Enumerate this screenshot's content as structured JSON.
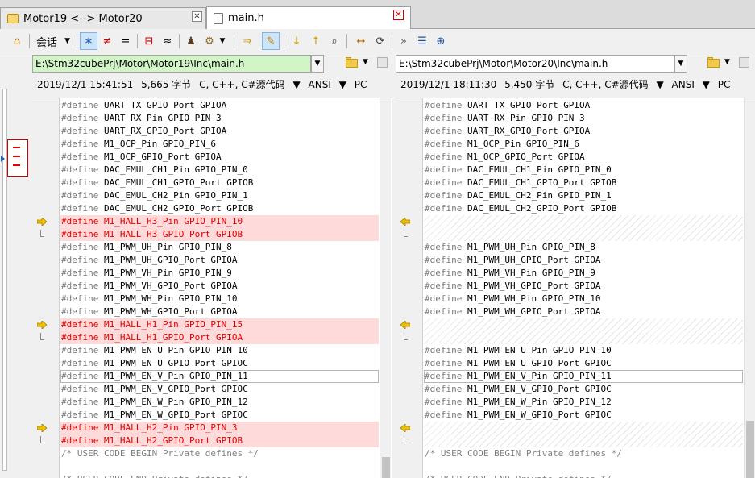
{
  "tabs": [
    {
      "label": "Motor19 <--> Motor20",
      "active": false
    },
    {
      "label": "main.h",
      "active": true
    }
  ],
  "toolbar": {
    "session_label": "会话",
    "items": [
      {
        "name": "home-icon",
        "glyph": "⌂"
      },
      {
        "name": "session-menu",
        "glyph": ""
      },
      {
        "name": "show-all-icon",
        "glyph": "∗"
      },
      {
        "name": "show-differences-icon",
        "glyph": "≠"
      },
      {
        "name": "show-same-icon",
        "glyph": "="
      },
      {
        "name": "structure-icon",
        "glyph": "⊟"
      },
      {
        "name": "similar-icon",
        "glyph": "≈"
      },
      {
        "name": "person-icon",
        "glyph": "♟"
      },
      {
        "name": "rules-icon",
        "glyph": "⚙"
      },
      {
        "name": "copy-arrow-icon",
        "glyph": "⇒"
      },
      {
        "name": "edit-pencil-icon",
        "glyph": "✎"
      },
      {
        "name": "next-diff-icon",
        "glyph": "↓"
      },
      {
        "name": "prev-diff-icon",
        "glyph": "↑"
      },
      {
        "name": "find-binoculars-icon",
        "glyph": "⌕"
      },
      {
        "name": "swap-icon",
        "glyph": "↔"
      },
      {
        "name": "refresh-icon",
        "glyph": "⟳"
      },
      {
        "name": "expand-icon",
        "glyph": "»"
      },
      {
        "name": "list-icon",
        "glyph": "☰"
      },
      {
        "name": "globe-icon",
        "glyph": "⊕"
      }
    ]
  },
  "left": {
    "path": "E:\\Stm32cubePrj\\Motor\\Motor19\\Inc\\main.h",
    "date": "2019/12/1 15:41:51",
    "size": "5,665 字节",
    "lang": "C, C++, C#源代码",
    "encoding": "ANSI",
    "lineend": "PC"
  },
  "right": {
    "path": "E:\\Stm32cubePrj\\Motor\\Motor20\\Inc\\main.h",
    "date": "2019/12/1 18:11:30",
    "size": "5,450 字节",
    "lang": "C, C++, C#源代码",
    "encoding": "ANSI",
    "lineend": "PC"
  },
  "rows": [
    {
      "left": "#define UART_TX_GPIO_Port GPIOA",
      "right": "#define UART_TX_GPIO_Port GPIOA",
      "type": "same"
    },
    {
      "left": "#define UART_RX_Pin GPIO_PIN_3",
      "right": "#define UART_RX_Pin GPIO_PIN_3",
      "type": "same"
    },
    {
      "left": "#define UART_RX_GPIO_Port GPIOA",
      "right": "#define UART_RX_GPIO_Port GPIOA",
      "type": "same"
    },
    {
      "left": "#define M1_OCP_Pin GPIO_PIN_6",
      "right": "#define M1_OCP_Pin GPIO_PIN_6",
      "type": "same"
    },
    {
      "left": "#define M1_OCP_GPIO_Port GPIOA",
      "right": "#define M1_OCP_GPIO_Port GPIOA",
      "type": "same"
    },
    {
      "left": "#define DAC_EMUL_CH1_Pin GPIO_PIN_0",
      "right": "#define DAC_EMUL_CH1_Pin GPIO_PIN_0",
      "type": "same"
    },
    {
      "left": "#define DAC_EMUL_CH1_GPIO_Port GPIOB",
      "right": "#define DAC_EMUL_CH1_GPIO_Port GPIOB",
      "type": "same"
    },
    {
      "left": "#define DAC_EMUL_CH2_Pin GPIO_PIN_1",
      "right": "#define DAC_EMUL_CH2_Pin GPIO_PIN_1",
      "type": "same"
    },
    {
      "left": "#define DAC_EMUL_CH2_GPIO_Port GPIOB",
      "right": "#define DAC_EMUL_CH2_GPIO_Port GPIOB",
      "type": "same"
    },
    {
      "left": "#define M1_HALL_H3_Pin GPIO_PIN_10",
      "right": "",
      "type": "diff-first"
    },
    {
      "left": "#define M1_HALL_H3_GPIO_Port GPIOB",
      "right": "",
      "type": "diff-cont"
    },
    {
      "left": "#define M1_PWM_UH_Pin GPIO_PIN_8",
      "right": "#define M1_PWM_UH_Pin GPIO_PIN_8",
      "type": "same"
    },
    {
      "left": "#define M1_PWM_UH_GPIO_Port GPIOA",
      "right": "#define M1_PWM_UH_GPIO_Port GPIOA",
      "type": "same"
    },
    {
      "left": "#define M1_PWM_VH_Pin GPIO_PIN_9",
      "right": "#define M1_PWM_VH_Pin GPIO_PIN_9",
      "type": "same"
    },
    {
      "left": "#define M1_PWM_VH_GPIO_Port GPIOA",
      "right": "#define M1_PWM_VH_GPIO_Port GPIOA",
      "type": "same"
    },
    {
      "left": "#define M1_PWM_WH_Pin GPIO_PIN_10",
      "right": "#define M1_PWM_WH_Pin GPIO_PIN_10",
      "type": "same"
    },
    {
      "left": "#define M1_PWM_WH_GPIO_Port GPIOA",
      "right": "#define M1_PWM_WH_GPIO_Port GPIOA",
      "type": "same"
    },
    {
      "left": "#define M1_HALL_H1_Pin GPIO_PIN_15",
      "right": "",
      "type": "diff-first"
    },
    {
      "left": "#define M1_HALL_H1_GPIO_Port GPIOA",
      "right": "",
      "type": "diff-cont"
    },
    {
      "left": "#define M1_PWM_EN_U_Pin GPIO_PIN_10",
      "right": "#define M1_PWM_EN_U_Pin GPIO_PIN_10",
      "type": "same"
    },
    {
      "left": "#define M1_PWM_EN_U_GPIO_Port GPIOC",
      "right": "#define M1_PWM_EN_U_GPIO_Port GPIOC",
      "type": "same"
    },
    {
      "left": "#define M1_PWM_EN_V_Pin GPIO_PIN_11",
      "right": "#define M1_PWM_EN_V_Pin GPIO_PIN_11",
      "type": "cur"
    },
    {
      "left": "#define M1_PWM_EN_V_GPIO_Port GPIOC",
      "right": "#define M1_PWM_EN_V_GPIO_Port GPIOC",
      "type": "same"
    },
    {
      "left": "#define M1_PWM_EN_W_Pin GPIO_PIN_12",
      "right": "#define M1_PWM_EN_W_Pin GPIO_PIN_12",
      "type": "same"
    },
    {
      "left": "#define M1_PWM_EN_W_GPIO_Port GPIOC",
      "right": "#define M1_PWM_EN_W_GPIO_Port GPIOC",
      "type": "same"
    },
    {
      "left": "#define M1_HALL_H2_Pin GPIO_PIN_3",
      "right": "",
      "type": "diff-first"
    },
    {
      "left": "#define M1_HALL_H2_GPIO_Port GPIOB",
      "right": "",
      "type": "diff-cont"
    },
    {
      "left": "/* USER CODE BEGIN Private defines */",
      "right": "/* USER CODE BEGIN Private defines */",
      "type": "comment"
    },
    {
      "left": "",
      "right": "",
      "type": "same"
    },
    {
      "left": "/* USER CODE END Private defines */",
      "right": "/* USER CODE END Private defines */",
      "type": "comment"
    }
  ]
}
